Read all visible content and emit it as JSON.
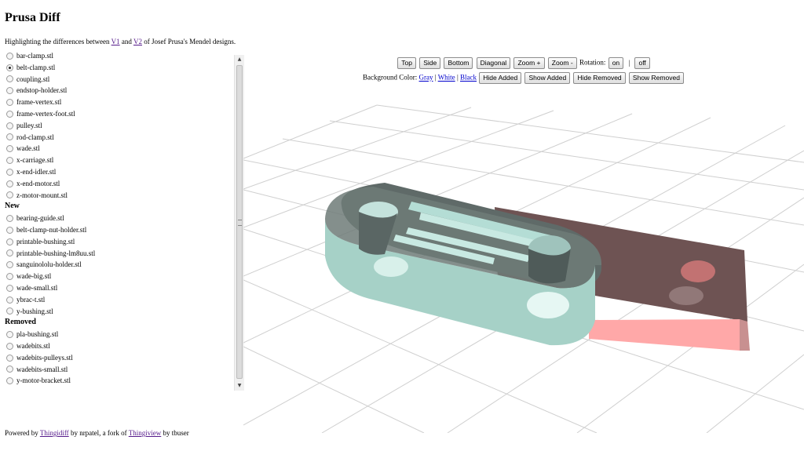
{
  "title": "Prusa Diff",
  "subtitle": {
    "before": "Highlighting the differences between ",
    "link_v1": "V1",
    "middle": " and ",
    "link_v2": "V2",
    "after": " of Josef Prusa's Mendel designs."
  },
  "files": {
    "changed": [
      "bar-clamp.stl",
      "belt-clamp.stl",
      "coupling.stl",
      "endstop-holder.stl",
      "frame-vertex.stl",
      "frame-vertex-foot.stl",
      "pulley.stl",
      "rod-clamp.stl",
      "wade.stl",
      "x-carriage.stl",
      "x-end-idler.stl",
      "x-end-motor.stl",
      "z-motor-mount.stl"
    ],
    "selected": "belt-clamp.stl",
    "new_heading": "New",
    "new": [
      "bearing-guide.stl",
      "belt-clamp-nut-holder.stl",
      "printable-bushing.stl",
      "printable-bushing-lm8uu.stl",
      "sanguinololu-holder.stl",
      "wade-big.stl",
      "wade-small.stl",
      "ybrac-t.stl",
      "y-bushing.stl"
    ],
    "removed_heading": "Removed",
    "removed": [
      "pla-bushing.stl",
      "wadebits.stl",
      "wadebits-pulleys.stl",
      "wadebits-small.stl",
      "y-motor-bracket.stl"
    ]
  },
  "controls": {
    "top": "Top",
    "side": "Side",
    "bottom": "Bottom",
    "diagonal": "Diagonal",
    "zoom_in": "Zoom +",
    "zoom_out": "Zoom -",
    "rotation_label": "Rotation:",
    "rotation_on": "on",
    "rotation_sep": "|",
    "rotation_off": "off",
    "bg_label": "Background Color:",
    "bg_gray": "Gray",
    "bg_white": "White",
    "bg_black": "Black",
    "hide_added": "Hide Added",
    "show_added": "Show Added",
    "hide_removed": "Hide Removed",
    "show_removed": "Show Removed"
  },
  "footer": {
    "powered": "Powered by ",
    "link_thingidiff": "Thingidiff",
    "by1": " by nrpatel, a fork of ",
    "link_thingiview": "Thingiview",
    "by2": " by tbuser"
  },
  "colors": {
    "added_model": "#a6d1c7",
    "removed_model": "#ffa8a8",
    "grid": "#cfcfcf"
  }
}
